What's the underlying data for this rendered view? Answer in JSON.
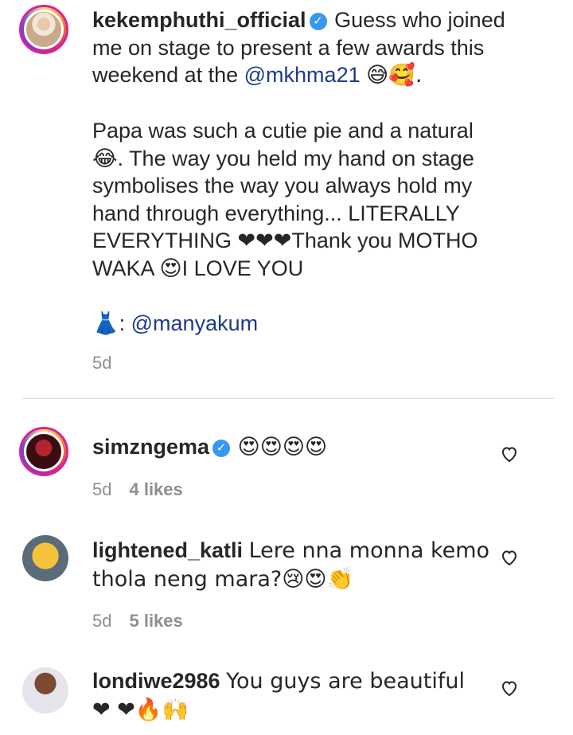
{
  "caption": {
    "username": "kekemphuthi_official",
    "line1": "Guess who joined me on stage to present a few awards this weekend at the ",
    "mention": "@mkhma21",
    "line1_emoji": "😅🥰.",
    "para2": "Papa was such a cutie pie and a natural 😂. The way you held my hand on stage symbolises the way you always hold my hand through everything... LITERALLY EVERYTHING ❤❤❤Thank you MOTHO WAKA 😍I LOVE YOU",
    "dress_emoji": "👗",
    "dress_sep": ": ",
    "dress_mention": "@manyakum",
    "time": "5d"
  },
  "comments": [
    {
      "username": "simzngema",
      "verified": true,
      "text": "😍😍😍😍",
      "time": "5d",
      "likes": "4 likes"
    },
    {
      "username": "lightened_katli",
      "verified": false,
      "text": "Lere nna monna kemo thola neng mara?😢😍👏",
      "time": "5d",
      "likes": "5 likes"
    },
    {
      "username": "londiwe2986",
      "verified": false,
      "text": "You guys are beautiful ❤ ❤🔥🙌"
    }
  ],
  "icons": {
    "verified": "verified-badge-icon",
    "like": "heart-outline-icon"
  },
  "colors": {
    "verified": "#3897f0",
    "mention": "#1e3a8a",
    "meta": "#8e8e8e",
    "divider": "#dbdbdb"
  }
}
